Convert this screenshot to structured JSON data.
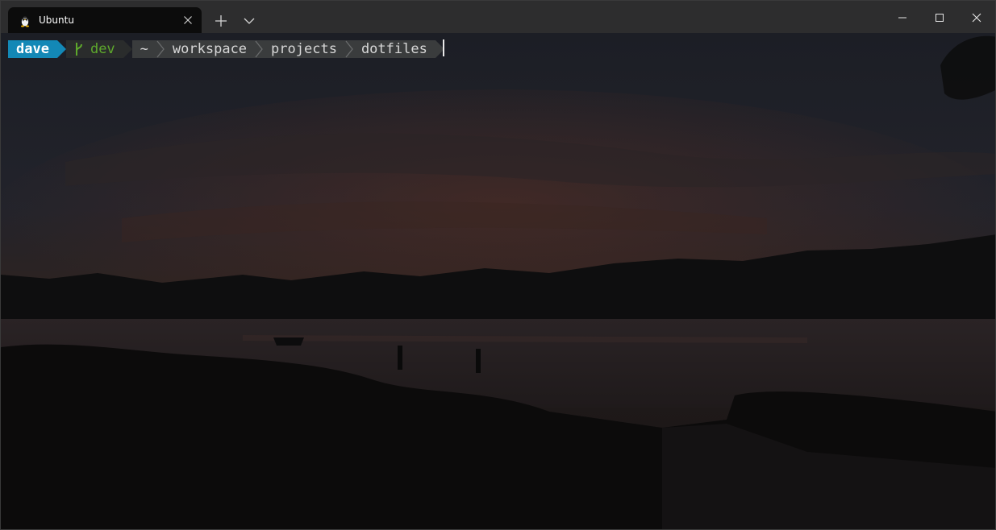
{
  "window": {
    "tab_title": "Ubuntu",
    "tab_icon": "tux-penguin-icon",
    "controls": {
      "new_tab_icon": "plus-icon",
      "dropdown_icon": "chevron-down-icon",
      "minimize_icon": "minimize-icon",
      "maximize_icon": "maximize-icon",
      "close_icon": "close-icon"
    }
  },
  "prompt": {
    "user": "dave",
    "branch_icon": "git-branch-icon",
    "branch": "dev",
    "path": [
      "~",
      "workspace",
      "projects",
      "dotfiles"
    ]
  },
  "colors": {
    "user_segment": "#1388b6",
    "branch_text": "#5ea82c",
    "path_segment": "#3a3c3d",
    "titlebar": "#2d2d2e",
    "active_tab": "#0c0c0c"
  }
}
